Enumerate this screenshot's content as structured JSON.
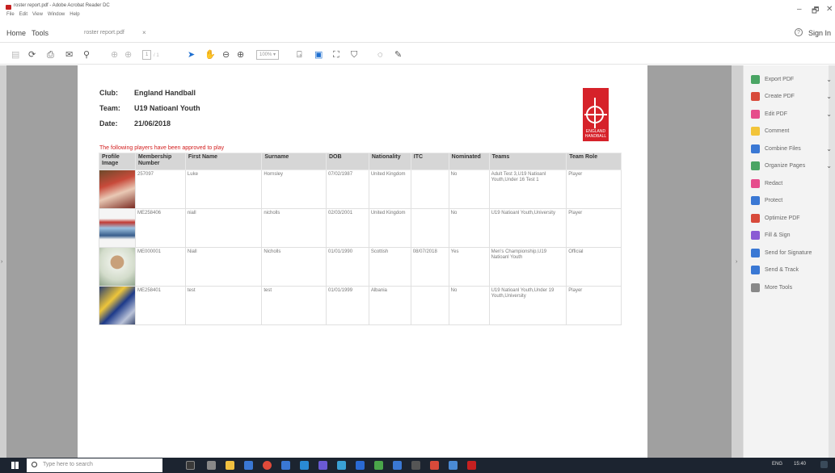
{
  "window": {
    "title": "roster report.pdf - Adobe Acrobat Reader DC",
    "menu": [
      "File",
      "Edit",
      "View",
      "Window",
      "Help"
    ],
    "minimize": "–",
    "maximize": "🗗",
    "close": "✕"
  },
  "nav": {
    "home": "Home",
    "tools": "Tools",
    "doc_tab": "roster report.pdf",
    "tab_close": "×",
    "help": "?",
    "sign_in": "Sign In"
  },
  "toolbar": {
    "page_field": "1",
    "page_total": "/ 1",
    "zoom": "100%"
  },
  "document": {
    "club_label": "Club:",
    "club_value": "England Handball",
    "team_label": "Team:",
    "team_value": "U19 Natioanl Youth",
    "date_label": "Date:",
    "date_value": "21/06/2018",
    "logo_text": "ENGLAND HANDBALL",
    "approval_note": "The following players have been approved to play",
    "columns": [
      "Profile Image",
      "Membership Number",
      "First Name",
      "Surname",
      "DOB",
      "Nationality",
      "ITC",
      "Nominated",
      "Teams",
      "Team Role"
    ],
    "rows": [
      {
        "membership": "257097",
        "first": "Luke",
        "surname": "Hornsley",
        "dob": "07/02/1987",
        "nationality": "United Kingdom",
        "itc": "",
        "nominated": "No",
        "teams": "Adult Test 3,U19 Natioanl Youth,Under 16 Test 1",
        "role": "Player"
      },
      {
        "membership": "ME258406",
        "first": "niall",
        "surname": "nicholls",
        "dob": "02/03/2001",
        "nationality": "United Kingdom",
        "itc": "",
        "nominated": "No",
        "teams": "U19 Natioanl Youth,University",
        "role": "Player"
      },
      {
        "membership": "ME000001",
        "first": "Niall",
        "surname": "Nicholls",
        "dob": "01/01/1990",
        "nationality": "Scottish",
        "itc": "08/07/2018",
        "nominated": "Yes",
        "teams": "Men's Championship,U19 Natioanl Youth",
        "role": "Official"
      },
      {
        "membership": "ME258401",
        "first": "test",
        "surname": "test",
        "dob": "01/01/1999",
        "nationality": "Albania",
        "itc": "",
        "nominated": "No",
        "teams": "U19 Natioanl Youth,Under 19 Youth,University",
        "role": "Player"
      }
    ]
  },
  "tools_panel": [
    {
      "label": "Export PDF",
      "color": "#4aa564",
      "chevron": true
    },
    {
      "label": "Create PDF",
      "color": "#d84a3a",
      "chevron": true
    },
    {
      "label": "Edit PDF",
      "color": "#e64c8c",
      "chevron": true
    },
    {
      "label": "Comment",
      "color": "#f2c43a",
      "chevron": false
    },
    {
      "label": "Combine Files",
      "color": "#3a78d4",
      "chevron": true
    },
    {
      "label": "Organize Pages",
      "color": "#4aa564",
      "chevron": true
    },
    {
      "label": "Redact",
      "color": "#e64c8c",
      "chevron": false
    },
    {
      "label": "Protect",
      "color": "#3a78d4",
      "chevron": false
    },
    {
      "label": "Optimize PDF",
      "color": "#d84a3a",
      "chevron": false
    },
    {
      "label": "Fill & Sign",
      "color": "#8a5ad4",
      "chevron": false
    },
    {
      "label": "Send for Signature",
      "color": "#3a78d4",
      "chevron": false
    },
    {
      "label": "Send & Track",
      "color": "#3a78d4",
      "chevron": false
    },
    {
      "label": "More Tools",
      "color": "#888888",
      "chevron": false
    }
  ],
  "taskbar": {
    "search_placeholder": "Type here to search",
    "lang": "ENG",
    "time": "15:40"
  }
}
